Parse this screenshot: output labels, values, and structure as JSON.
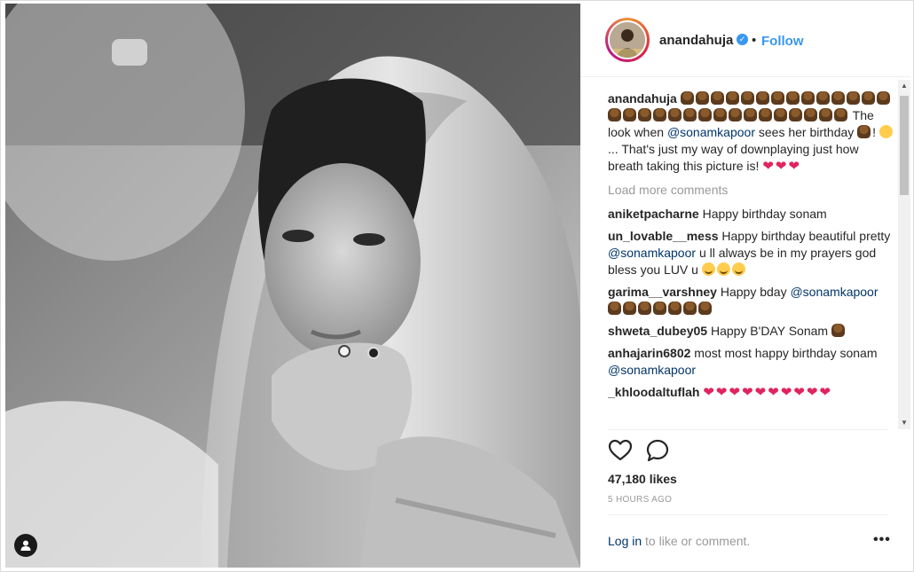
{
  "post": {
    "username": "anandahuja",
    "follow_label": "Follow",
    "separator": "•",
    "caption": {
      "user": "anandahuja",
      "text_1": "The look when",
      "mention": "@sonamkapoor",
      "text_2": "sees her birthday",
      "text_3": "!",
      "text_4": "...",
      "text_5": "That's just my way of downplaying just how breath taking this picture is!"
    },
    "load_more": "Load more comments",
    "comments": [
      {
        "user": "aniketpacharne",
        "text": "Happy birthday sonam"
      },
      {
        "user": "un_lovable__mess",
        "text_1": "Happy birthday beautiful pretty",
        "mention": "@sonamkapoor",
        "text_2": "u ll always be in my prayers god bless you LUV u"
      },
      {
        "user": "garima__varshney",
        "text_1": "Happy bday",
        "mention": "@sonamkapoor"
      },
      {
        "user": "shweta_dubey05",
        "text": "Happy B'DAY Sonam"
      },
      {
        "user": "anhajarin6802",
        "text_1": "most most happy birthday sonam",
        "mention": "@sonamkapoor"
      },
      {
        "user": "_khloodaltuflah",
        "text": ""
      }
    ],
    "likes": "47,180 likes",
    "time": "5 HOURS AGO",
    "login_link": "Log in",
    "login_text": "to like or comment.",
    "more_label": "•••",
    "icons": [
      "like-heart-icon",
      "comment-bubble-icon",
      "user-tag-icon",
      "verified-badge-icon",
      "cake-emoji",
      "heart-emoji",
      "smiley-emoji",
      "laughing-emoji"
    ],
    "colors": {
      "accent": "#3897f0",
      "mention": "#003569",
      "muted": "#999999",
      "heart": "#e0245e"
    }
  }
}
